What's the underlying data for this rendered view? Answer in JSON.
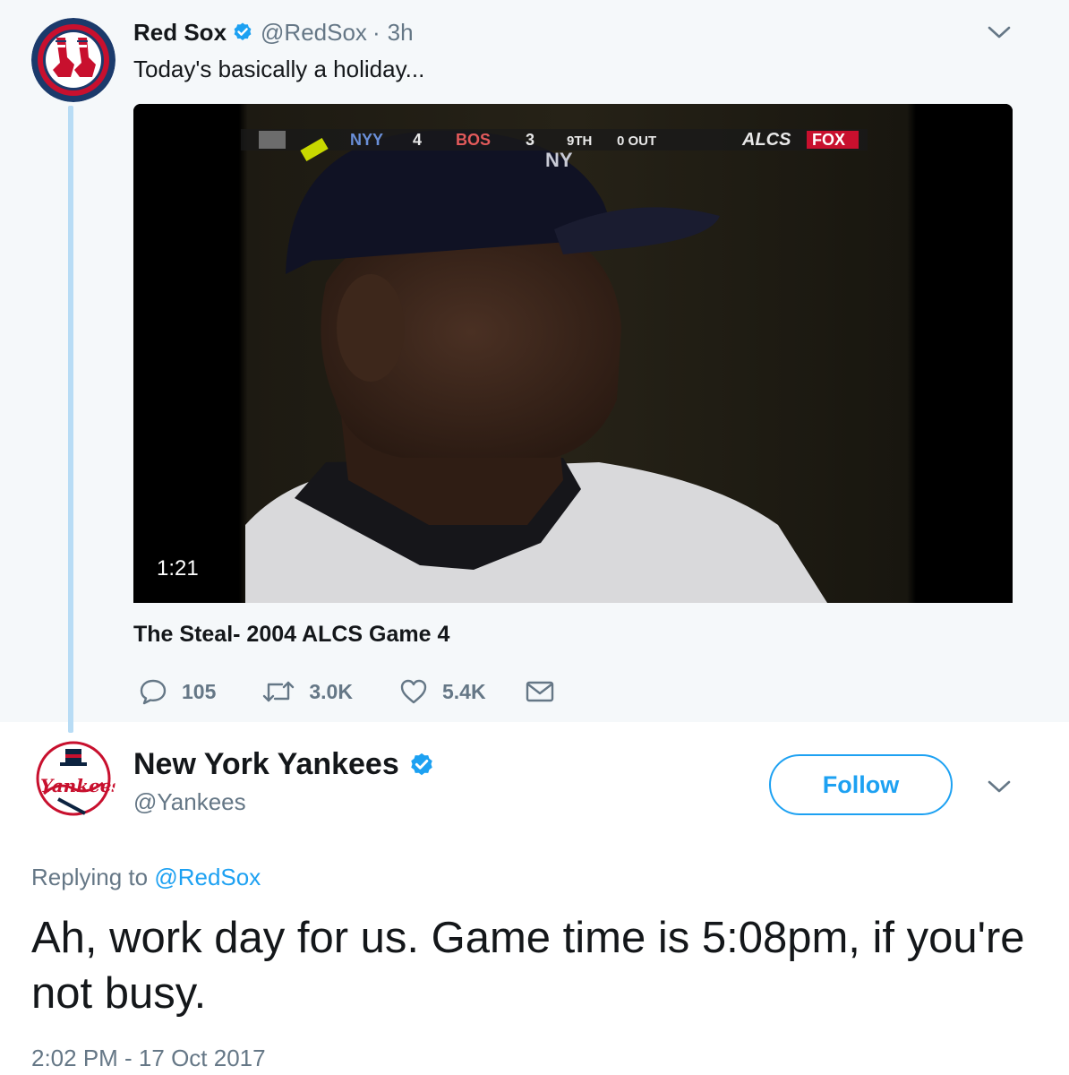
{
  "parent_tweet": {
    "author_name": "Red Sox",
    "author_handle": "@RedSox",
    "separator": "·",
    "time_ago": "3h",
    "text": "Today's basically a holiday...",
    "video": {
      "duration": "1:21",
      "scorebug": {
        "away_team": "NYY",
        "away_score": "4",
        "home_team": "BOS",
        "home_score": "3",
        "inning": "9TH",
        "outs": "0 OUT",
        "series": "ALCS",
        "network": "FOX"
      }
    },
    "card_title": "The Steal- 2004 ALCS Game 4",
    "counts": {
      "replies": "105",
      "retweets": "3.0K",
      "likes": "5.4K"
    }
  },
  "reply_tweet": {
    "author_name": "New York Yankees",
    "author_handle": "@Yankees",
    "follow_label": "Follow",
    "replying_prefix": "Replying to",
    "replying_handle": "@RedSox",
    "text": "Ah, work day for us. Game time is 5:08pm, if you're not busy.",
    "timestamp": "2:02 PM - 17 Oct 2017"
  },
  "colors": {
    "twitter_blue": "#1da1f2",
    "secondary_text": "#657786",
    "thread_line": "#b8dcf5",
    "parent_background": "#f5f8fa",
    "redsox_navy": "#1b3a6b",
    "redsox_red": "#c8102e",
    "yankees_navy": "#0c2340"
  },
  "icons": {
    "verified": "verified-badge-icon",
    "caret": "chevron-down-icon",
    "reply": "reply-bubble-icon",
    "retweet": "retweet-icon",
    "like": "heart-icon",
    "dm": "envelope-icon"
  }
}
